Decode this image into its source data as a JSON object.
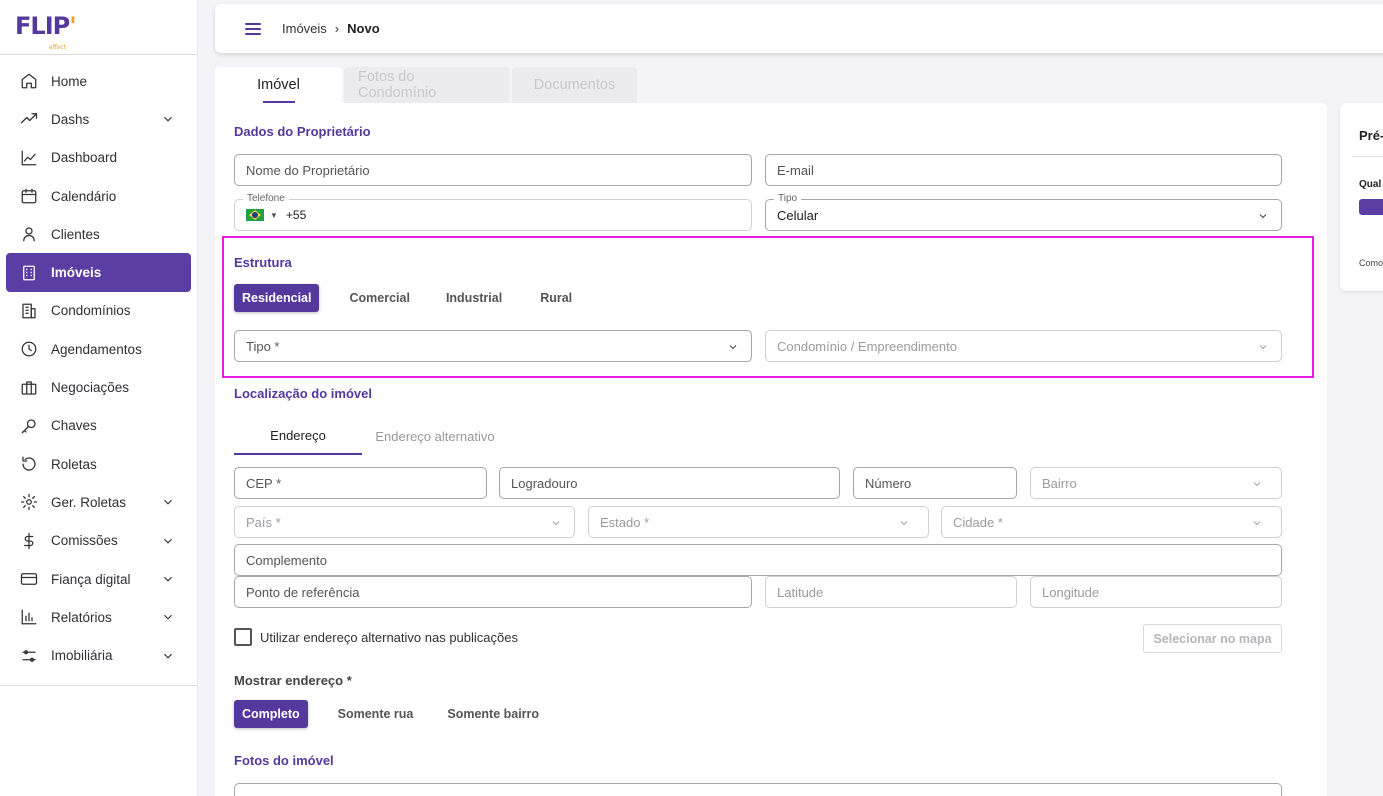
{
  "brand": {
    "logo_main": "FLIP",
    "logo_dot": "'",
    "logo_sub": "effect"
  },
  "sidebar": {
    "items": [
      {
        "label": "Home",
        "icon": "home-icon",
        "expandable": false
      },
      {
        "label": "Dashs",
        "icon": "trending-up-icon",
        "expandable": true
      },
      {
        "label": "Dashboard",
        "icon": "line-chart-icon",
        "expandable": false
      },
      {
        "label": "Calendário",
        "icon": "calendar-icon",
        "expandable": false
      },
      {
        "label": "Clientes",
        "icon": "user-icon",
        "expandable": false
      },
      {
        "label": "Imóveis",
        "icon": "building-icon",
        "expandable": false,
        "active": true
      },
      {
        "label": "Condomínios",
        "icon": "buildings-icon",
        "expandable": false
      },
      {
        "label": "Agendamentos",
        "icon": "clock-icon",
        "expandable": false
      },
      {
        "label": "Negociações",
        "icon": "briefcase-icon",
        "expandable": false
      },
      {
        "label": "Chaves",
        "icon": "key-icon",
        "expandable": false
      },
      {
        "label": "Roletas",
        "icon": "rotate-icon",
        "expandable": false
      },
      {
        "label": "Ger. Roletas",
        "icon": "gear-icon",
        "expandable": true
      },
      {
        "label": "Comissões",
        "icon": "dollar-icon",
        "expandable": true
      },
      {
        "label": "Fiança digital",
        "icon": "credit-card-icon",
        "expandable": true
      },
      {
        "label": "Relatórios",
        "icon": "bar-chart-icon",
        "expandable": true
      },
      {
        "label": "Imobiliária",
        "icon": "sliders-icon",
        "expandable": true
      }
    ]
  },
  "header": {
    "breadcrumb_parent": "Imóveis",
    "breadcrumb_sep": "›",
    "breadcrumb_current": "Novo"
  },
  "tabs": [
    "Imóvel",
    "Fotos do Condomínio",
    "Documentos"
  ],
  "owner": {
    "title": "Dados do Proprietário",
    "name_placeholder": "Nome do Proprietário",
    "email_placeholder": "E-mail",
    "phone_label": "Telefone",
    "phone_prefix": "+55",
    "type_label": "Tipo",
    "type_value": "Celular"
  },
  "structure": {
    "title": "Estrutura",
    "options": [
      "Residencial",
      "Comercial",
      "Industrial",
      "Rural"
    ],
    "selected": "Residencial",
    "type_placeholder": "Tipo *",
    "condo_placeholder": "Condomínio / Empreendimento"
  },
  "location": {
    "title": "Localização do imóvel",
    "subtabs": [
      "Endereço",
      "Endereço alternativo"
    ],
    "cep": "CEP *",
    "street": "Logradouro",
    "number": "Número",
    "district": "Bairro",
    "country": "País *",
    "state": "Estado *",
    "city": "Cidade *",
    "complement": "Complemento",
    "reference": "Ponto de referência",
    "latitude": "Latitude",
    "longitude": "Longitude",
    "alt_checkbox": "Utilizar endereço alternativo nas publicações",
    "map_button": "Selecionar no mapa"
  },
  "show_address": {
    "title": "Mostrar endereço *",
    "options": [
      "Completo",
      "Somente rua",
      "Somente bairro"
    ],
    "selected": "Completo"
  },
  "photos": {
    "title": "Fotos do imóvel"
  },
  "right_panel": {
    "title": "Pré-",
    "small": "Qual",
    "foot": "Como"
  },
  "colors": {
    "accent": "#55389e",
    "highlight": "#ec1ce0",
    "secondary": "#f0a21e"
  }
}
